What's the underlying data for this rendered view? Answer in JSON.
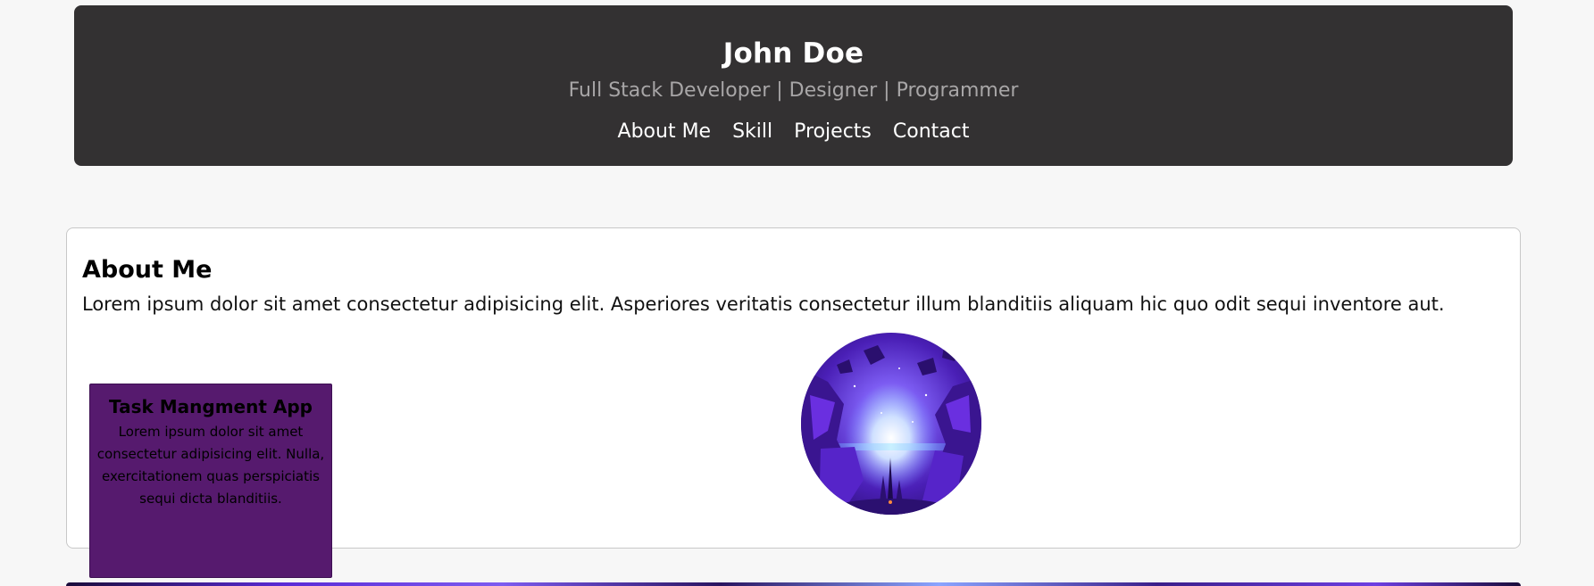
{
  "header": {
    "name": "John Doe",
    "tagline": "Full Stack Developer | Designer | Programmer",
    "nav": [
      {
        "label": "About Me"
      },
      {
        "label": "Skill"
      },
      {
        "label": "Projects"
      },
      {
        "label": "Contact"
      }
    ]
  },
  "about": {
    "title": "About Me",
    "text": "Lorem ipsum dolor sit amet consectetur adipisicing elit. Asperiores veritatis consectetur illum blanditiis aliquam hic quo odit sequi inventore aut."
  },
  "project_card": {
    "title": "Task Mangment App",
    "description": "Lorem ipsum dolor sit amet consectetur adipisicing elit. Nulla, exercitationem quas perspiciatis sequi dicta blanditiis."
  },
  "colors": {
    "header_bg": "#333132",
    "page_bg": "#f7f7f7",
    "card_bg": "#561a6e",
    "tagline": "#a8a6a7"
  }
}
